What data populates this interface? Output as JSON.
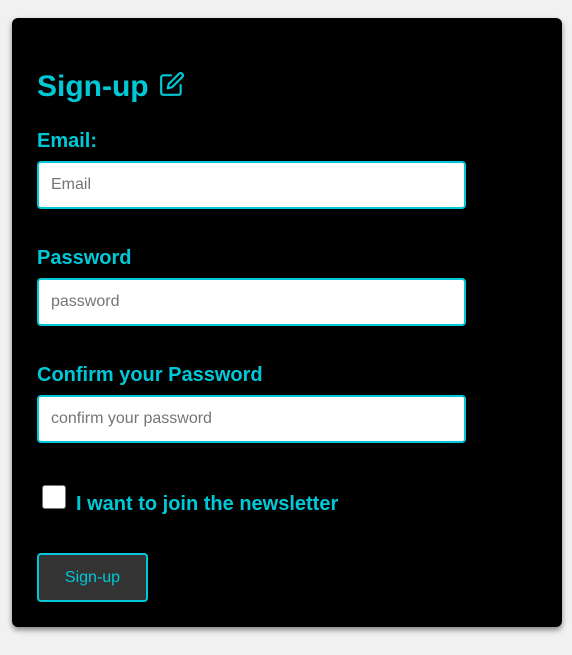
{
  "form": {
    "title": "Sign-up",
    "title_icon": "edit-icon",
    "email": {
      "label": "Email:",
      "placeholder": "Email",
      "value": ""
    },
    "password": {
      "label": "Password",
      "placeholder": "password",
      "value": ""
    },
    "confirm": {
      "label": "Confirm your Password",
      "placeholder": "confirm your password",
      "value": ""
    },
    "newsletter": {
      "label": "I want to join the newsletter",
      "checked": false
    },
    "submit_label": "Sign-up"
  },
  "colors": {
    "accent": "#00c8d7",
    "card_background": "#000000",
    "page_background": "#f1f1f1",
    "button_background": "#333333"
  }
}
